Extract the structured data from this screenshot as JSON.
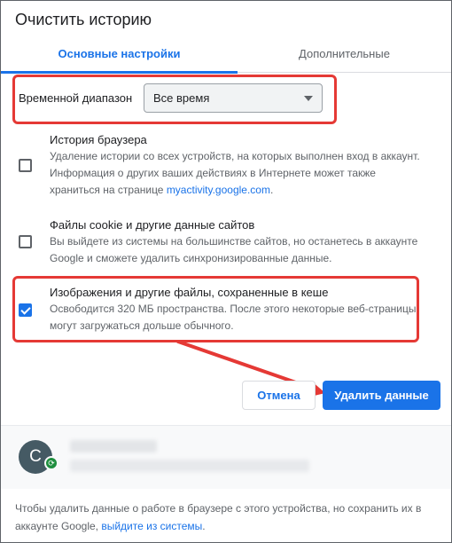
{
  "dialog": {
    "title": "Очистить историю",
    "tabs": [
      {
        "label": "Основные настройки",
        "active": true
      },
      {
        "label": "Дополнительные",
        "active": false
      }
    ]
  },
  "time_range": {
    "label": "Временной диапазон",
    "value": "Все время"
  },
  "items": [
    {
      "title": "История браузера",
      "desc_pre": "Удаление истории со всех устройств, на которых выполнен вход в аккаунт. Информация о других ваших действиях в Интернете может также храниться на странице ",
      "link": "myactivity.google.com",
      "desc_post": ".",
      "checked": false
    },
    {
      "title": "Файлы cookie и другие данные сайтов",
      "desc": "Вы выйдете из системы на большинстве сайтов, но останетесь в аккаунте Google и сможете удалить синхронизированные данные.",
      "checked": false
    },
    {
      "title": "Изображения и другие файлы, сохраненные в кеше",
      "desc": "Освободится 320 МБ пространства. После этого некоторые веб-страницы могут загружаться дольше обычного.",
      "checked": true
    }
  ],
  "buttons": {
    "cancel": "Отмена",
    "delete": "Удалить данные"
  },
  "account": {
    "avatar_letter": "C"
  },
  "footer": {
    "text": "Чтобы удалить данные о работе в браузере с этого устройства, но сохранить их в аккаунте Google, ",
    "link": "выйдите из системы",
    "end": "."
  },
  "colors": {
    "accent": "#1a73e8",
    "highlight": "#e53935"
  }
}
